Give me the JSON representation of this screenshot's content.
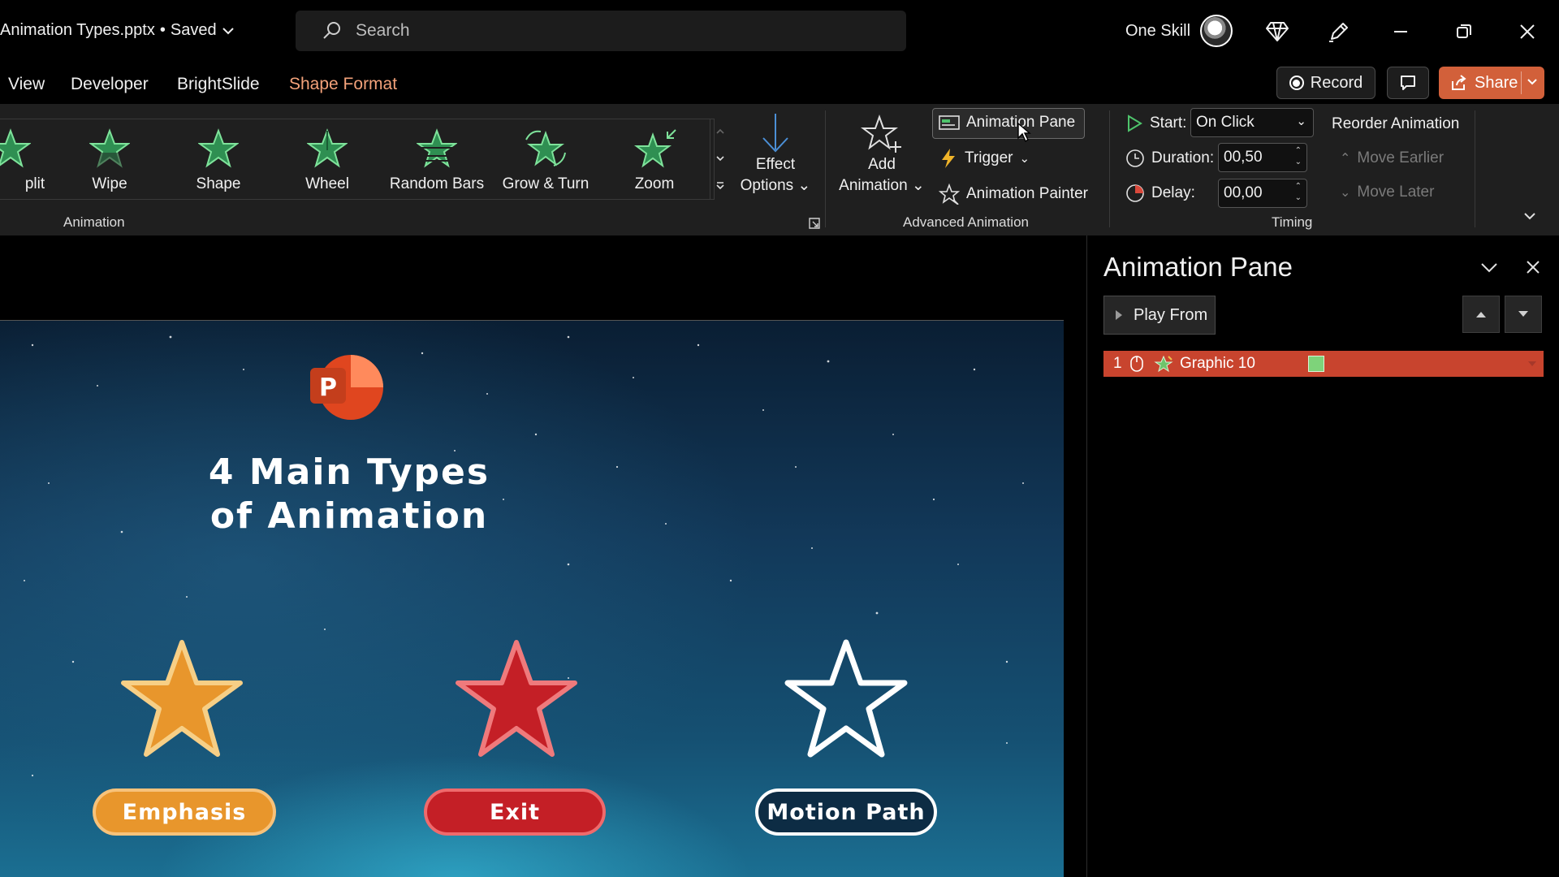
{
  "titlebar": {
    "doc_name": "Animation Types.pptx",
    "separator": "•",
    "save_status": "Saved",
    "search_placeholder": "Search",
    "user_name": "One Skill"
  },
  "menu": {
    "tabs": [
      "View",
      "Developer",
      "BrightSlide",
      "Shape Format"
    ],
    "active_tab": "Shape Format",
    "record_label": "Record",
    "share_label": "Share"
  },
  "ribbon": {
    "animation_gallery": [
      {
        "label": "plit",
        "icon": "split-star-icon"
      },
      {
        "label": "Wipe",
        "icon": "wipe-star-icon"
      },
      {
        "label": "Shape",
        "icon": "shape-star-icon"
      },
      {
        "label": "Wheel",
        "icon": "wheel-star-icon"
      },
      {
        "label": "Random Bars",
        "icon": "random-bars-star-icon"
      },
      {
        "label": "Grow & Turn",
        "icon": "grow-turn-star-icon"
      },
      {
        "label": "Zoom",
        "icon": "zoom-star-icon"
      }
    ],
    "effect_options": {
      "line1": "Effect",
      "line2": "Options"
    },
    "animation_group_label": "Animation",
    "add_animation": {
      "line1": "Add",
      "line2": "Animation"
    },
    "animation_pane_label": "Animation Pane",
    "trigger_label": "Trigger",
    "animation_painter_label": "Animation Painter",
    "advanced_group_label": "Advanced Animation",
    "timing": {
      "start_label": "Start:",
      "start_value": "On Click",
      "duration_label": "Duration:",
      "duration_value": "00,50",
      "delay_label": "Delay:",
      "delay_value": "00,00",
      "group_label": "Timing"
    },
    "reorder": {
      "title": "Reorder Animation",
      "move_earlier": "Move Earlier",
      "move_later": "Move Later"
    }
  },
  "slide": {
    "title_line1": "4 Main Types",
    "title_line2": "of Animation",
    "logo_letter": "P",
    "buttons": {
      "emphasis": "Emphasis",
      "exit": "Exit",
      "motion_path": "Motion Path"
    },
    "colors": {
      "emphasis": "#e8962c",
      "exit": "#c41f26",
      "motion": "#ffffff"
    }
  },
  "pane": {
    "title": "Animation Pane",
    "play_from_label": "Play From",
    "items": [
      {
        "number": "1",
        "name": "Graphic 10"
      }
    ]
  }
}
